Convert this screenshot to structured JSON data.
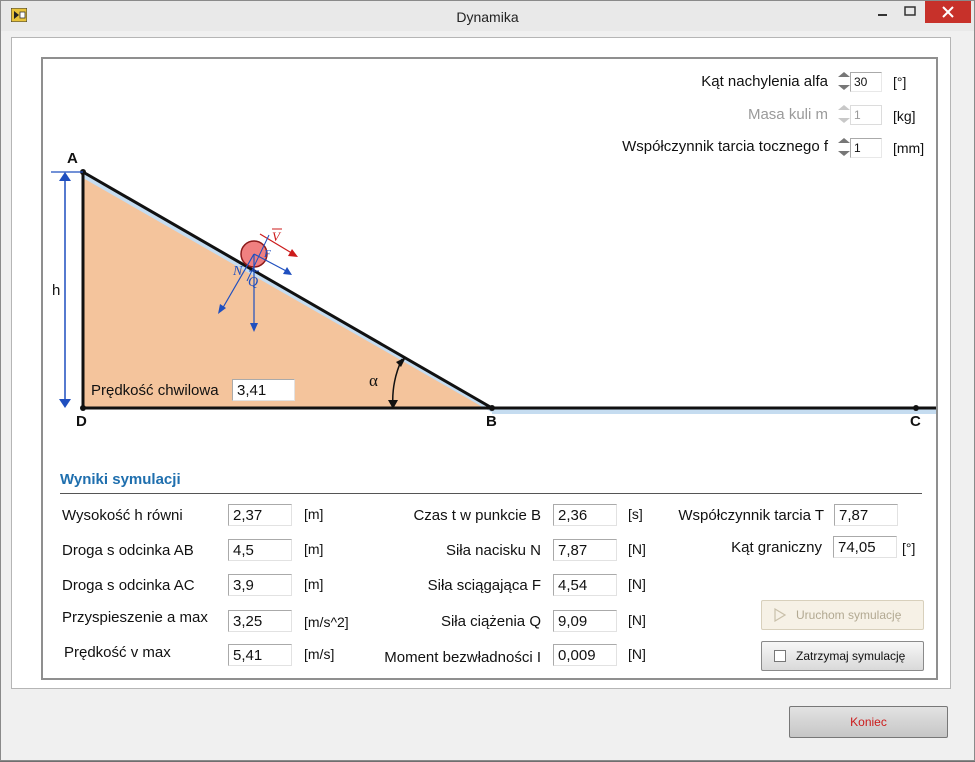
{
  "window": {
    "title": "Dynamika"
  },
  "controls": {
    "angle": {
      "label": "Kąt nachylenia alfa",
      "value": "30",
      "unit": "[°]"
    },
    "mass": {
      "label": "Masa kuli m",
      "value": "1",
      "unit": "[kg]"
    },
    "friction": {
      "label": "Współczynnik tarcia tocznego f",
      "value": "1",
      "unit": "[mm]"
    }
  },
  "diagram": {
    "points": {
      "a": "A",
      "b": "B",
      "c": "C",
      "d": "D"
    },
    "height_label": "h",
    "alpha_label": "α",
    "vector_v": "V",
    "vector_f": "F",
    "vector_n": "N",
    "vector_q": "Q",
    "speed_label": "Prędkość chwilowa",
    "speed_value": "3,41"
  },
  "results": {
    "title": "Wyniki symulacji",
    "col1": [
      {
        "label": "Wysokość h równi",
        "value": "2,37",
        "unit": "[m]"
      },
      {
        "label": "Droga s odcinka AB",
        "value": "4,5",
        "unit": "[m]"
      },
      {
        "label": "Droga s odcinka AC",
        "value": "3,9",
        "unit": "[m]"
      },
      {
        "label": "Przyspieszenie a max",
        "value": "3,25",
        "unit": "[m/s^2]"
      },
      {
        "label": "Prędkość v max",
        "value": "5,41",
        "unit": "[m/s]"
      }
    ],
    "col2": [
      {
        "label": "Czas t w punkcie B",
        "value": "2,36",
        "unit": "[s]"
      },
      {
        "label": "Siła nacisku N",
        "value": "7,87",
        "unit": "[N]"
      },
      {
        "label": "Siła sciągająca F",
        "value": "4,54",
        "unit": "[N]"
      },
      {
        "label": "Siła ciążenia Q",
        "value": "9,09",
        "unit": "[N]"
      },
      {
        "label": "Moment bezwładności I",
        "value": "0,009",
        "unit": "[N]"
      }
    ],
    "col3": [
      {
        "label": "Współczynnik tarcia T",
        "value": "7,87",
        "unit": ""
      },
      {
        "label": "Kąt graniczny",
        "value": "74,05",
        "unit": "[°]"
      }
    ]
  },
  "buttons": {
    "start": "Uruchom symulację",
    "stop": "Zatrzymaj symulację",
    "end": "Koniec"
  },
  "colors": {
    "incline_fill": "#f4c49c",
    "track_blue": "#c5dcf0",
    "vector_blue": "#1f4fbf",
    "vector_red": "#cc1b1b",
    "ball_fill": "#f08080",
    "accent_title": "#1f6fae"
  }
}
